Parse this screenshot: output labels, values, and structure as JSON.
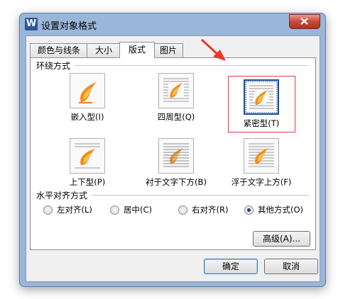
{
  "window": {
    "title": "设置对象格式",
    "app_icon": "W",
    "close_icon": "close-icon"
  },
  "tabs": [
    {
      "label": "颜色与线条",
      "active": false
    },
    {
      "label": "大小",
      "active": false
    },
    {
      "label": "版式",
      "active": true
    },
    {
      "label": "图片",
      "active": false
    }
  ],
  "wrap_section": {
    "label": "环绕方式",
    "options": [
      {
        "label": "嵌入型(I)",
        "selected": false
      },
      {
        "label": "四周型(Q)",
        "selected": false
      },
      {
        "label": "紧密型(T)",
        "selected": true
      },
      {
        "label": "上下型(P)",
        "selected": false
      },
      {
        "label": "衬于文字下方(B)",
        "selected": false
      },
      {
        "label": "浮于文字上方(F)",
        "selected": false
      }
    ]
  },
  "align_section": {
    "label": "水平对齐方式",
    "options": [
      {
        "label": "左对齐(L)",
        "checked": false
      },
      {
        "label": "居中(C)",
        "checked": false
      },
      {
        "label": "右对齐(R)",
        "checked": false
      },
      {
        "label": "其他方式(O)",
        "checked": true
      }
    ]
  },
  "buttons": {
    "advanced": "高级(A)...",
    "ok": "确定",
    "cancel": "取消"
  },
  "colors": {
    "highlight": "#e23c3c",
    "accent": "#1f4f9a"
  }
}
